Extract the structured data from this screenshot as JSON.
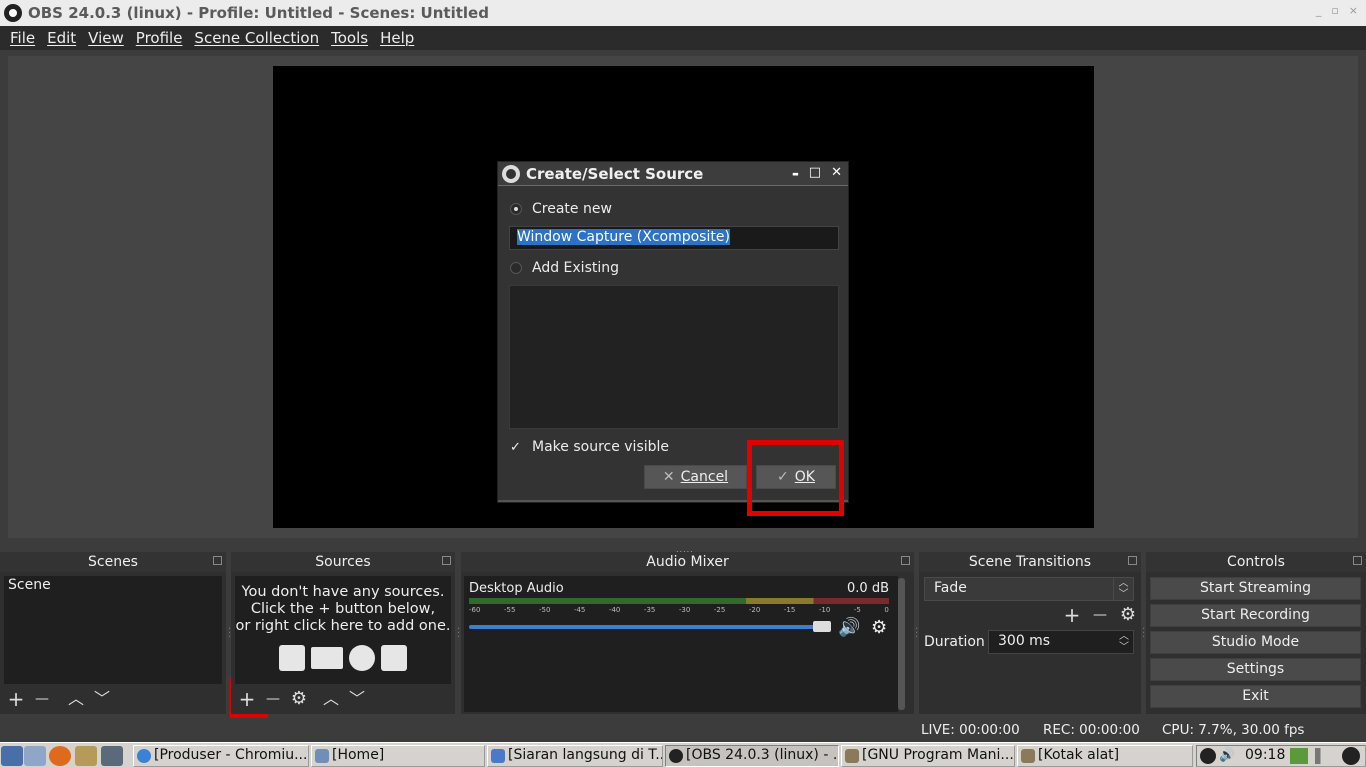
{
  "window": {
    "title": "OBS 24.0.3 (linux) - Profile: Untitled - Scenes: Untitled",
    "controls": [
      "_",
      "▫",
      "×"
    ]
  },
  "menu": [
    "File",
    "Edit",
    "View",
    "Profile",
    "Scene Collection",
    "Tools",
    "Help"
  ],
  "dialog": {
    "title": "Create/Select Source",
    "create_new_label": "Create new",
    "create_new_selected": true,
    "name_value": "Window Capture (Xcomposite)",
    "add_existing_label": "Add Existing",
    "make_visible_label": "Make source visible",
    "make_visible_checked": true,
    "cancel_label": "Cancel",
    "ok_label": "OK",
    "check_mark": "✓",
    "cancel_icon": "✕",
    "title_controls": [
      "▬",
      "□",
      "✕"
    ]
  },
  "docks": {
    "scenes": {
      "title": "Scenes",
      "items": [
        "Scene"
      ]
    },
    "sources": {
      "title": "Sources",
      "empty_line1": "You don't have any sources.",
      "empty_line2": "Click the + button below,",
      "empty_line3": "or right click here to add one."
    },
    "mixer": {
      "title": "Audio Mixer",
      "channel_name": "Desktop Audio",
      "channel_level": "0.0 dB",
      "ticks": [
        "-60",
        "-55",
        "-50",
        "-45",
        "-40",
        "-35",
        "-30",
        "-25",
        "-20",
        "-15",
        "-10",
        "-5",
        "0"
      ],
      "volume_fraction": 1.0
    },
    "transitions": {
      "title": "Scene Transitions",
      "selected": "Fade",
      "duration_label": "Duration",
      "duration_value": "300 ms"
    },
    "controls": {
      "title": "Controls",
      "buttons": [
        "Start Streaming",
        "Start Recording",
        "Studio Mode",
        "Settings",
        "Exit"
      ]
    }
  },
  "tool_glyphs": {
    "add": "+",
    "remove": "—",
    "up": "︿",
    "down": "﹀",
    "gear": "⚙",
    "speaker": "🔊"
  },
  "status": {
    "live": "LIVE: 00:00:00",
    "rec": "REC: 00:00:00",
    "cpu": "CPU: 7.7%, 30.00 fps"
  },
  "taskbar": {
    "tasks": [
      "[Produser - Chromiu...",
      "[Home]",
      "[Siaran langsung di T...",
      "[OBS 24.0.3 (linux) - ...",
      "[GNU Program Mani...",
      "[Kotak alat]"
    ],
    "clock": "09:18"
  },
  "colors": {
    "highlight": "#e00000",
    "selection": "#2a73c7",
    "volume": "#3a7fd0"
  }
}
